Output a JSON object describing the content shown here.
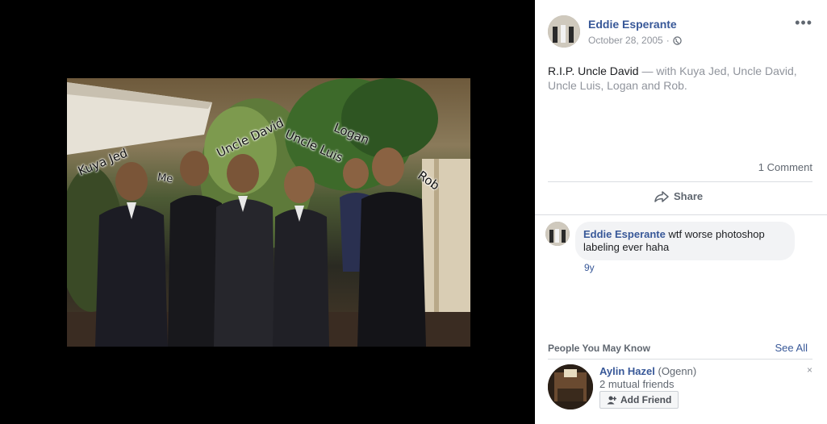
{
  "photo": {
    "labels": [
      "Kuya Jed",
      "Me",
      "Uncle David",
      "Uncle Luis",
      "Logan",
      "Rob"
    ]
  },
  "post": {
    "author": "Eddie Esperante",
    "date": "October 28, 2005",
    "audience_icon": "globe-icon",
    "more": "•••",
    "caption_main": "R.I.P. Uncle David",
    "caption_with": " — with Kuya Jed, Uncle David, Uncle Luis, Logan and Rob.",
    "comment_count": "1 Comment",
    "share_label": "Share"
  },
  "comments": [
    {
      "author": "Eddie Esperante",
      "text": " wtf worse photoshop labeling ever haha",
      "time": "9y"
    }
  ],
  "pymk": {
    "title": "People You May Know",
    "see_all": "See All",
    "people": [
      {
        "name": "Aylin Hazel",
        "alt_name": " (Ogenn)",
        "mutual": "2 mutual friends",
        "add_label": "Add Friend",
        "dismiss": "×"
      }
    ]
  },
  "colors": {
    "link": "#385898",
    "muted": "#90949c",
    "divider": "#dadde1"
  }
}
